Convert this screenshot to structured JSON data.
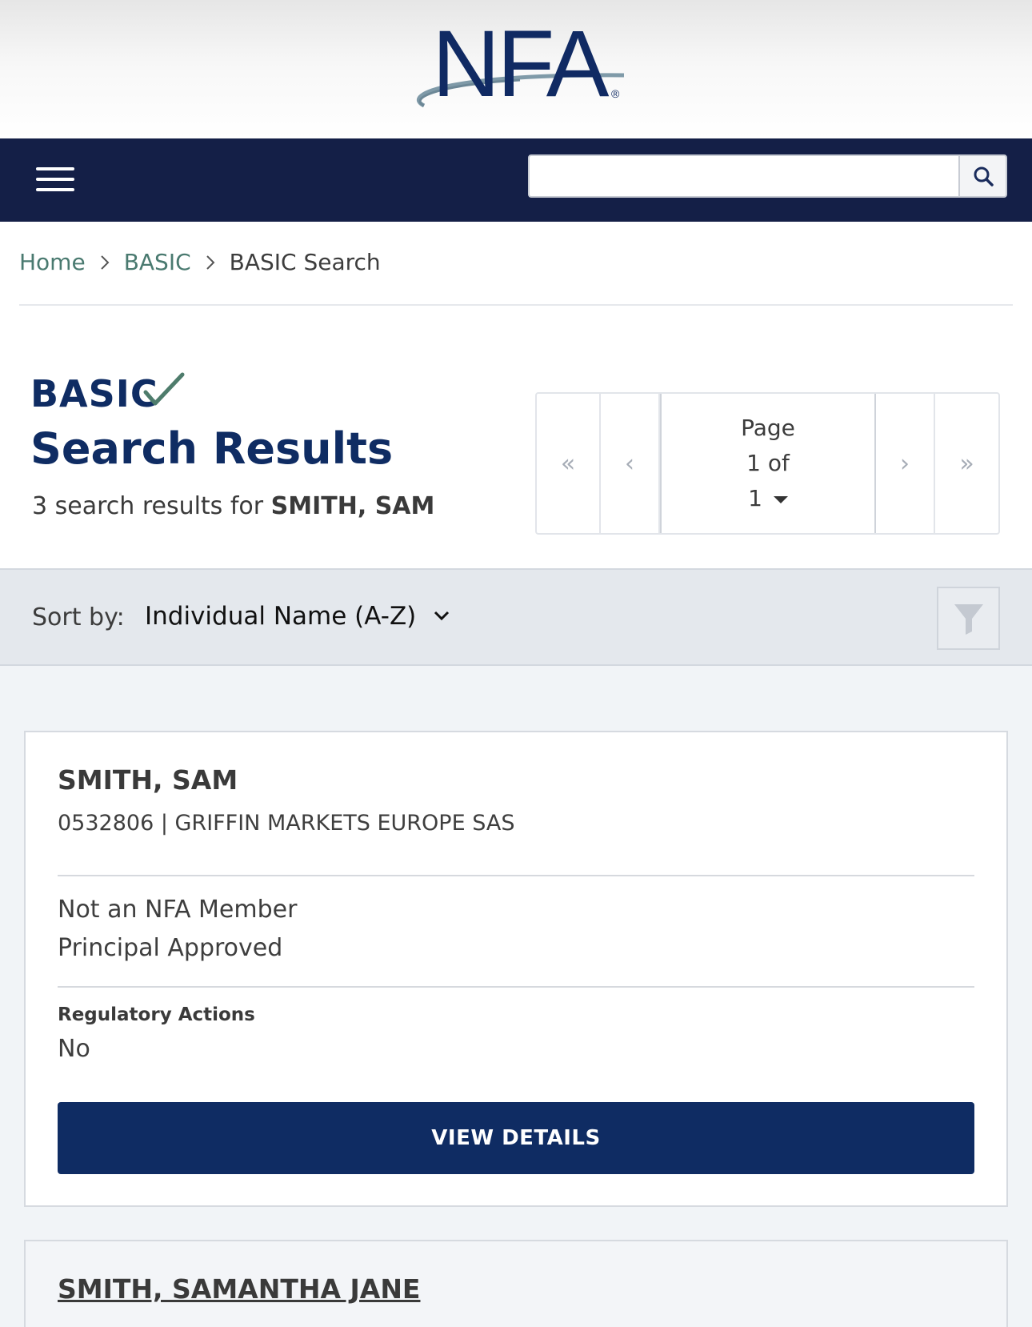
{
  "header": {
    "logo_text": "NFA",
    "logo_registered": "®"
  },
  "navbar": {
    "search_placeholder": "",
    "search_value": ""
  },
  "breadcrumb": {
    "items": [
      {
        "label": "Home"
      },
      {
        "label": "BASIC"
      }
    ],
    "current": "BASIC Search"
  },
  "page": {
    "basic_logo_text": "BASIC",
    "title": "Search Results",
    "result_count_prefix": "3 search results for",
    "query": "SMITH, SAM"
  },
  "pager": {
    "first": "«",
    "prev": "‹",
    "page_label": "Page",
    "page_of": "1 of",
    "total_pages": "1",
    "next": "›",
    "last": "»"
  },
  "sort": {
    "label": "Sort by:",
    "selected": "Individual Name (A-Z)"
  },
  "results": [
    {
      "name": "SMITH, SAM",
      "subline": "0532806 | GRIFFIN MARKETS EUROPE SAS",
      "membership": "Not an NFA Member",
      "status": "Principal Approved",
      "regulatory_label": "Regulatory Actions",
      "regulatory_value": "No",
      "button": "VIEW DETAILS"
    },
    {
      "name": "SMITH, SAMANTHA JANE"
    }
  ],
  "colors": {
    "navy": "#0f2c63",
    "navbar": "#141f47",
    "link_green": "#4a7a70"
  },
  "icons": [
    "menu-icon",
    "search-icon",
    "chevron-right-icon",
    "chevron-down-icon",
    "filter-icon",
    "checkmark-icon"
  ]
}
